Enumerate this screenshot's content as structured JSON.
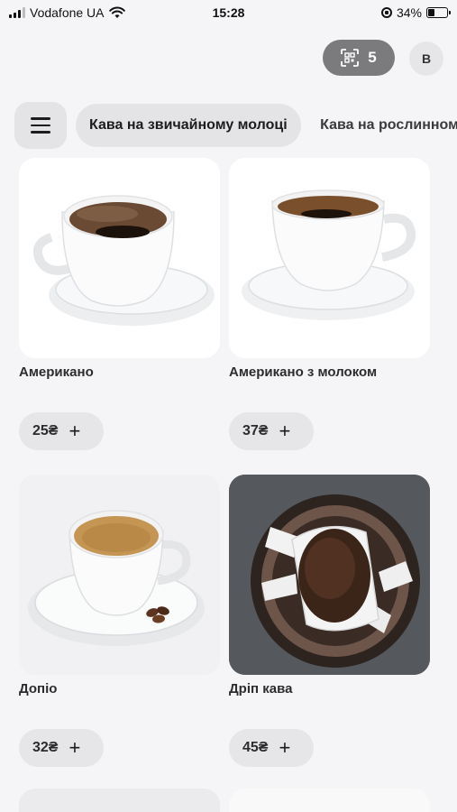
{
  "status_bar": {
    "carrier": "Vodafone UA",
    "time": "15:28",
    "battery_percent": "34%",
    "battery_level": 0.34
  },
  "header": {
    "qr_count": "5",
    "avatar_initial": "B"
  },
  "categories": [
    {
      "label": "Кава на звичайному молоці",
      "active": true
    },
    {
      "label": "Кава на рослинному",
      "active": false
    }
  ],
  "products": [
    {
      "name": "Американо",
      "price": "25₴"
    },
    {
      "name": "Американо з молоком",
      "price": "37₴"
    },
    {
      "name": "Допіо",
      "price": "32₴"
    },
    {
      "name": "Дріп кава",
      "price": "45₴"
    }
  ],
  "icons": {
    "add": "plus-icon",
    "menu": "hamburger-icon",
    "qr": "qr-scan-icon"
  },
  "colors": {
    "background": "#f5f5f7",
    "pill": "#e6e6e9",
    "qr_pill": "#7b7b7e"
  }
}
